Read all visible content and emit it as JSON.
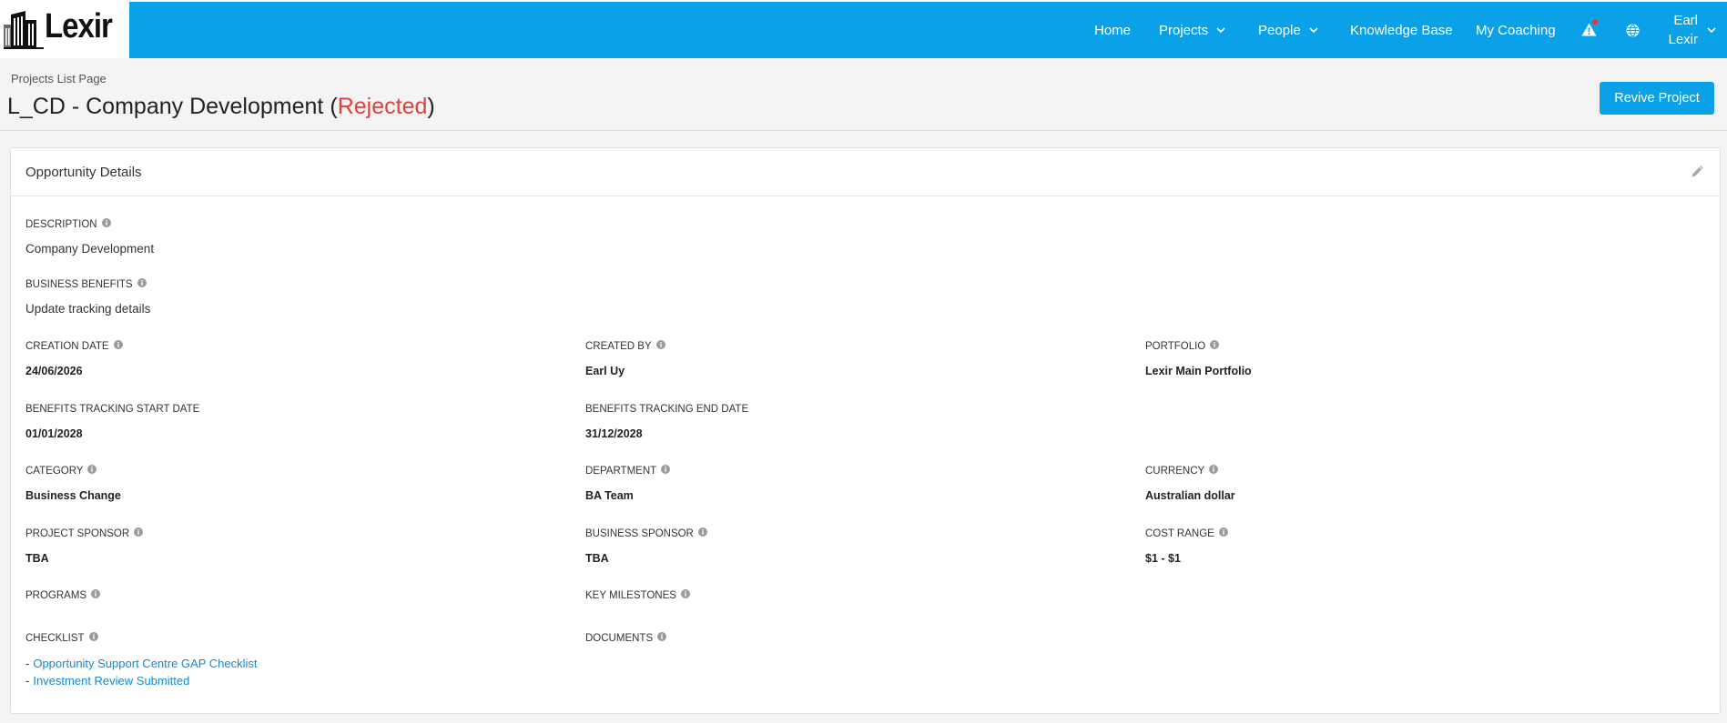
{
  "theme": {
    "primary": "#0aa1e8",
    "danger": "#e0413c",
    "link": "#1689d0",
    "logo_ink": "#111111"
  },
  "icons": {
    "logo": "building-icon",
    "dropdown": "chevron-down-icon",
    "alerts": "warning-icon",
    "language": "globe-icon",
    "edit": "pencil-icon",
    "info": "info-icon"
  },
  "header": {
    "logo_text": "Lexir",
    "nav": {
      "home": "Home",
      "projects": "Projects",
      "people": "People",
      "knowledge_base": "Knowledge Base",
      "my_coaching": "My Coaching"
    },
    "alerts": {
      "has_unread": true
    },
    "user": {
      "first_line": "Earl",
      "second_line": "Lexir"
    }
  },
  "page": {
    "breadcrumb": "Projects List Page",
    "title": {
      "name": "L_CD - Company Development",
      "paren_open": "(",
      "status": "Rejected",
      "paren_close": ")"
    },
    "revive_button": "Revive Project"
  },
  "opportunity_details": {
    "title": "Opportunity Details",
    "description": {
      "label": "DESCRIPTION",
      "value": "Company Development"
    },
    "business_benefits": {
      "label": "BUSINESS BENEFITS",
      "value": "Update tracking details"
    },
    "creation_date": {
      "label": "CREATION DATE",
      "value": "24/06/2026"
    },
    "created_by": {
      "label": "CREATED BY",
      "value": "Earl Uy"
    },
    "portfolio": {
      "label": "PORTFOLIO",
      "value": "Lexir Main Portfolio"
    },
    "benefits_tracking_start_date": {
      "label": "BENEFITS TRACKING START DATE",
      "value": "01/01/2028"
    },
    "benefits_tracking_end_date": {
      "label": "BENEFITS TRACKING END DATE",
      "value": "31/12/2028"
    },
    "category": {
      "label": "CATEGORY",
      "value": "Business Change"
    },
    "department": {
      "label": "DEPARTMENT",
      "value": "BA Team"
    },
    "currency": {
      "label": "CURRENCY",
      "value": "Australian dollar"
    },
    "project_sponsor": {
      "label": "PROJECT SPONSOR",
      "value": "TBA"
    },
    "business_sponsor": {
      "label": "BUSINESS SPONSOR",
      "value": "TBA"
    },
    "cost_range": {
      "label": "COST RANGE",
      "value": "$1 - $1"
    },
    "programs": {
      "label": "PROGRAMS"
    },
    "key_milestones": {
      "label": "KEY MILESTONES"
    },
    "checklist": {
      "label": "CHECKLIST",
      "bullet": "-",
      "items": [
        "Opportunity Support Centre GAP Checklist",
        "Investment Review Submitted"
      ]
    },
    "documents": {
      "label": "DOCUMENTS"
    }
  }
}
